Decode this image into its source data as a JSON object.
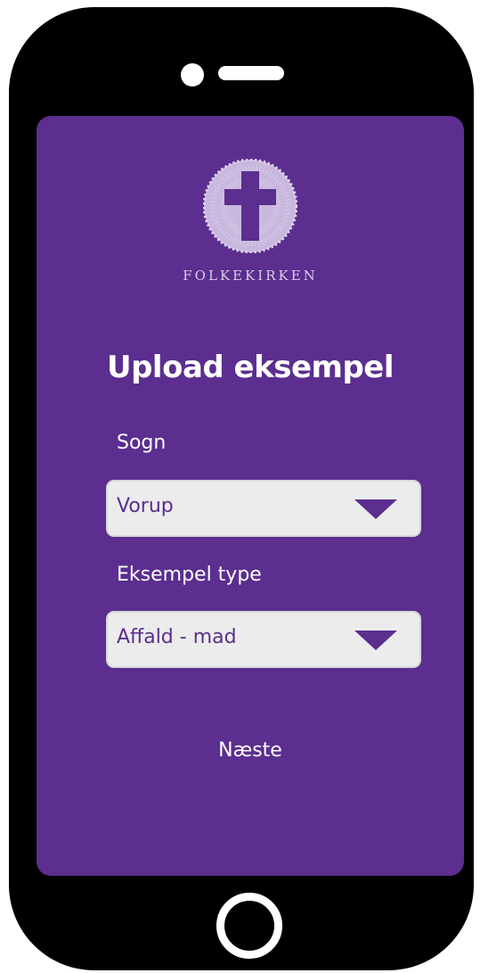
{
  "app": {
    "brand_name": "FOLKEKIRKEN",
    "logo_icon": "cross-emblem"
  },
  "page": {
    "title": "Upload eksempel"
  },
  "form": {
    "parish": {
      "label": "Sogn",
      "value": "Vorup"
    },
    "example_type": {
      "label": "Eksempel type",
      "value": "Affald - mad"
    }
  },
  "actions": {
    "next_label": "Næste"
  },
  "colors": {
    "screen_background": "#5b2e8f",
    "device_frame": "#000000",
    "select_background": "#ececec",
    "accent_text": "#5b2e8f"
  }
}
